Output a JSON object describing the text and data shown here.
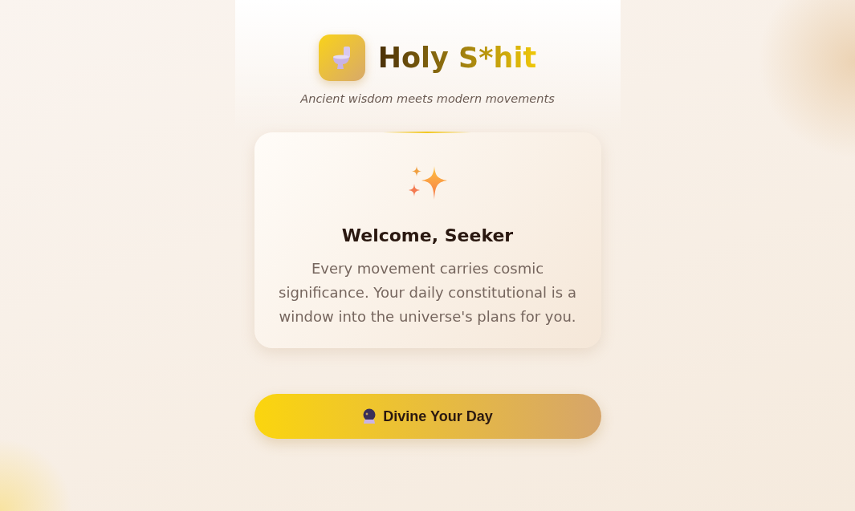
{
  "header": {
    "title": "Holy S*hit",
    "tagline": "Ancient wisdom meets modern movements"
  },
  "welcome_card": {
    "heading": "Welcome, Seeker",
    "body": "Every movement carries cosmic significance. Your daily constitutional is a window into the universe's plans for you."
  },
  "action_button": {
    "label": "Divine Your Day"
  }
}
